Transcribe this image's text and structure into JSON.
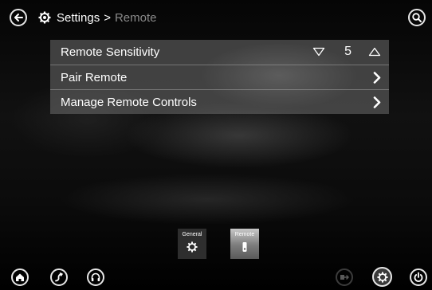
{
  "header": {
    "breadcrumb_root": "Settings",
    "breadcrumb_sep": ">",
    "breadcrumb_current": "Remote"
  },
  "settings": {
    "sensitivity": {
      "label": "Remote Sensitivity",
      "value": "5"
    },
    "pair": {
      "label": "Pair Remote"
    },
    "manage": {
      "label": "Manage Remote Controls"
    }
  },
  "tabs": [
    {
      "label": "General",
      "icon": "gear-icon",
      "active": false
    },
    {
      "label": "Remote",
      "icon": "remote-icon",
      "active": true
    }
  ],
  "bottom_nav": {
    "left": [
      "home-icon",
      "route-icon",
      "headphones-icon"
    ],
    "right": [
      "exit-icon",
      "settings-icon",
      "power-icon"
    ]
  },
  "colors": {
    "panel": "#6e6e6e",
    "text": "#ffffff",
    "breadcrumb_current": "#8a8a8a",
    "active_tab": "#9a9a9a"
  }
}
